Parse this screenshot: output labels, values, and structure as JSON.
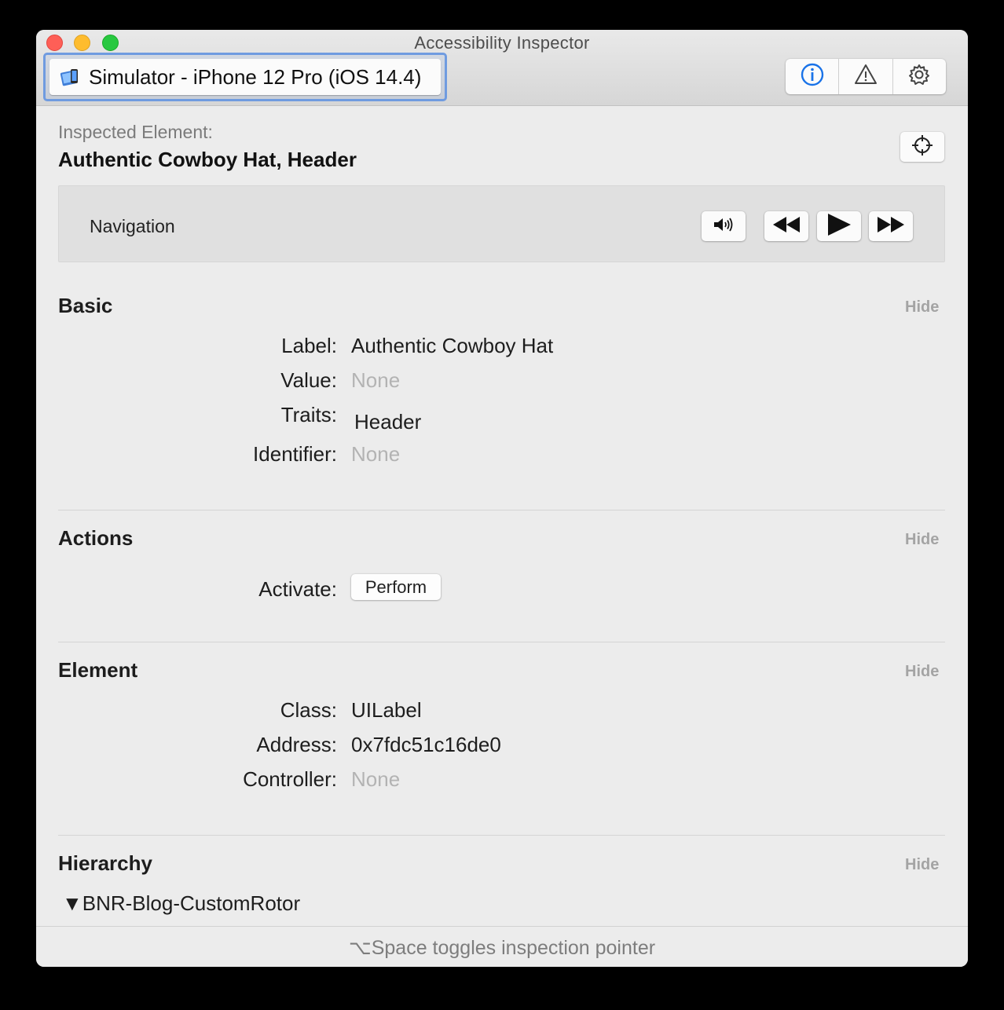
{
  "window": {
    "title": "Accessibility Inspector"
  },
  "toolbar": {
    "device_picker_label": "Simulator - iPhone 12 Pro (iOS 14.4)",
    "device_icon": "simulator-icon",
    "segments": [
      {
        "name": "inspection",
        "icon": "info-icon",
        "selected": true
      },
      {
        "name": "audit",
        "icon": "warning-icon",
        "selected": false
      },
      {
        "name": "settings",
        "icon": "gear-icon",
        "selected": false
      }
    ],
    "accent_color": "#1a73e8"
  },
  "inspected": {
    "caption": "Inspected Element:",
    "title": "Authentic Cowboy Hat, Header"
  },
  "navigation": {
    "label": "Navigation",
    "speak_icon": "speaker-icon",
    "previous_icon": "rewind-icon",
    "activate_icon": "play-icon",
    "next_icon": "fast-forward-icon"
  },
  "sections": {
    "basic": {
      "title": "Basic",
      "hide": "Hide",
      "rows": [
        {
          "key": "Label:",
          "value": "Authentic Cowboy Hat"
        },
        {
          "key": "Value:",
          "value": "None"
        },
        {
          "key": "Traits:",
          "value": "Header"
        },
        {
          "key": "Identifier:",
          "value": "None"
        }
      ]
    },
    "actions": {
      "title": "Actions",
      "hide": "Hide",
      "activate_key": "Activate:",
      "perform_label": "Perform"
    },
    "element": {
      "title": "Element",
      "hide": "Hide",
      "rows": [
        {
          "key": "Class:",
          "value": "UILabel"
        },
        {
          "key": "Address:",
          "value": "0x7fdc51c16de0"
        },
        {
          "key": "Controller:",
          "value": "None"
        }
      ]
    },
    "hierarchy": {
      "title": "Hierarchy",
      "hide": "Hide",
      "root": "▼BNR-Blog-CustomRotor"
    }
  },
  "footer": {
    "hint": "⌥Space toggles inspection pointer"
  }
}
